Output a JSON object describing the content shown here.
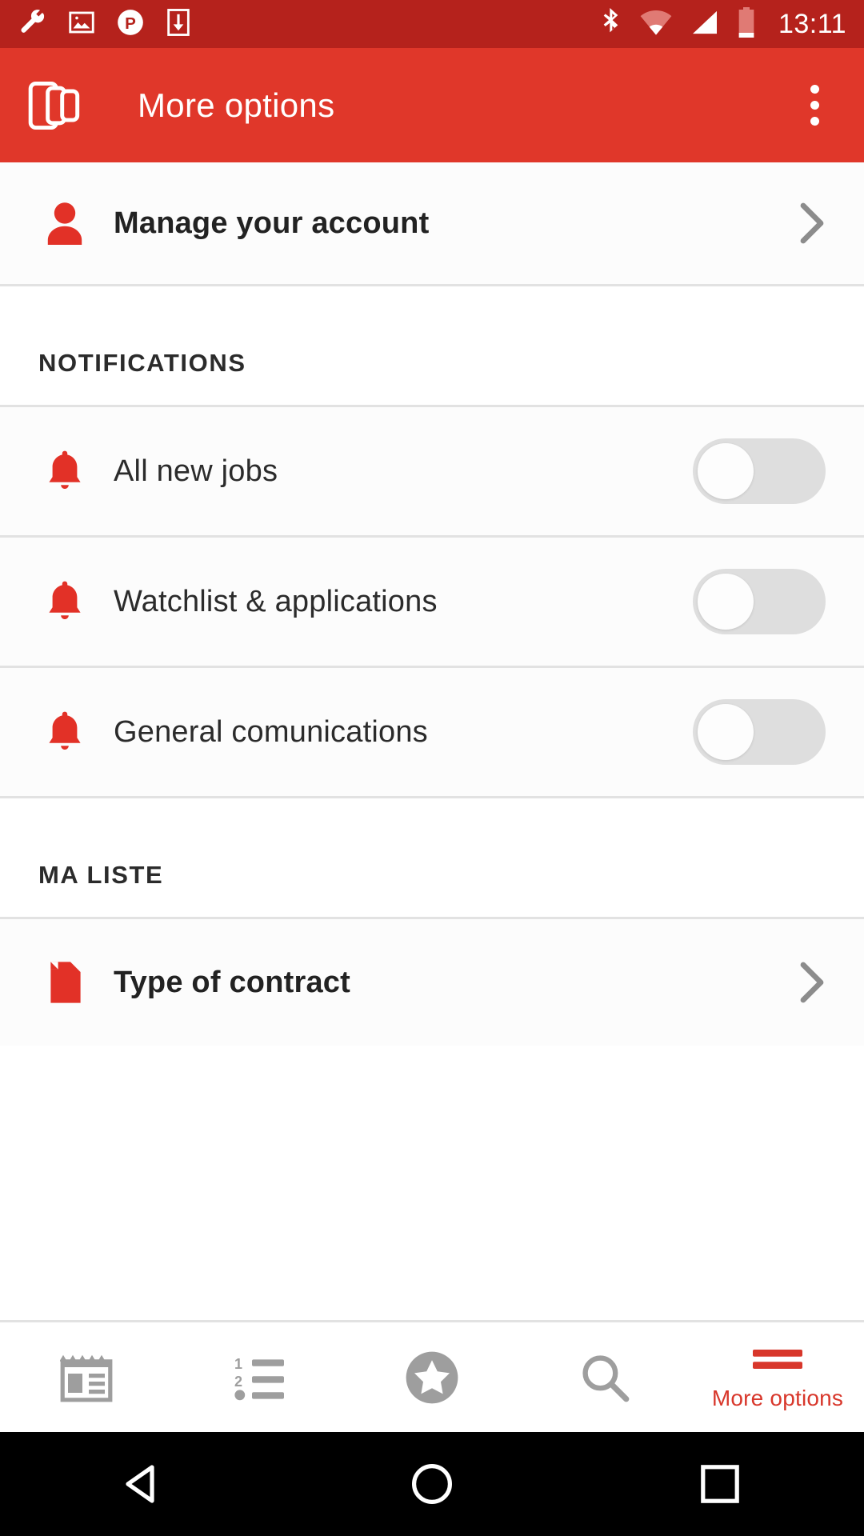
{
  "status_bar": {
    "time": "13:11",
    "left_icons": [
      {
        "name": "wrench-icon",
        "glyph": "wrench"
      },
      {
        "name": "screenshot-image-icon",
        "glyph": "image"
      },
      {
        "name": "parking-p-icon",
        "glyph": "p-circle"
      },
      {
        "name": "download-icon",
        "glyph": "download"
      }
    ],
    "right_icons": [
      {
        "name": "bluetooth-icon",
        "glyph": "bluetooth"
      },
      {
        "name": "wifi-icon",
        "glyph": "wifi"
      },
      {
        "name": "cell-signal-icon",
        "glyph": "signal"
      },
      {
        "name": "battery-icon",
        "glyph": "battery-low"
      }
    ]
  },
  "app_bar": {
    "title": "More options",
    "logo_name": "stacked-cards-logo",
    "overflow_name": "overflow-menu-icon",
    "background": "#E0372A"
  },
  "account": {
    "label": "Manage your account",
    "icon": "person-icon",
    "chevron": "chevron-right-icon"
  },
  "sections": [
    {
      "title": "NOTIFICATIONS",
      "rows": [
        {
          "label": "All new jobs",
          "icon": "bell-icon",
          "toggle": "off"
        },
        {
          "label": "Watchlist & applications",
          "icon": "bell-icon",
          "toggle": "off"
        },
        {
          "label": "General comunications",
          "icon": "bell-icon",
          "toggle": "off"
        }
      ]
    },
    {
      "title": "MA LISTE",
      "rows": [
        {
          "label": "Type of contract",
          "icon": "document-icon",
          "chevron": "chevron-right-icon"
        }
      ]
    }
  ],
  "tab_bar": {
    "tabs": [
      {
        "name": "tab-jobs",
        "icon": "calendar-icon",
        "label": "",
        "active": false
      },
      {
        "name": "tab-list",
        "icon": "list-icon",
        "label": "",
        "active": false
      },
      {
        "name": "tab-favorites",
        "icon": "star-circle-icon",
        "label": "",
        "active": false
      },
      {
        "name": "tab-search",
        "icon": "search-icon",
        "label": "",
        "active": false
      },
      {
        "name": "tab-more-options",
        "icon": "hamburger-icon",
        "label": "More options",
        "active": true
      }
    ],
    "active_color": "#D8372B",
    "inactive_color": "#9E9E9E"
  },
  "nav_bar": {
    "back": "back-triangle-icon",
    "home": "home-circle-icon",
    "recents": "recents-square-icon"
  },
  "colors": {
    "status_bar_bg": "#B5221C",
    "app_bar_bg": "#E0372A",
    "accent_red": "#E23127",
    "divider": "#E2E2E2",
    "row_bg": "#FCFCFC",
    "text": "#2B2B2B"
  }
}
